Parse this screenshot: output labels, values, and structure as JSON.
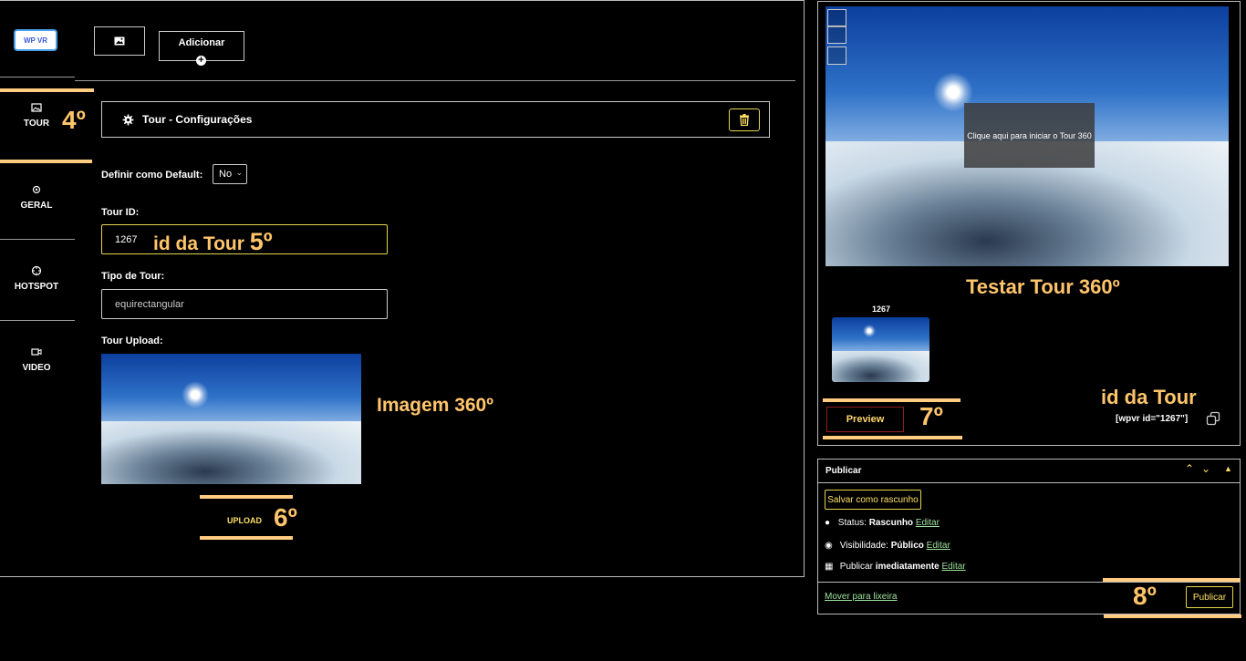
{
  "logo": {
    "text": "WP VR"
  },
  "sidebar": {
    "items": [
      {
        "label": "TOUR",
        "icon": "image-icon"
      },
      {
        "label": "GERAL",
        "icon": "gear-icon"
      },
      {
        "label": "HOTSPOT",
        "icon": "crosshair-icon"
      },
      {
        "label": "VIDEO",
        "icon": "video-icon"
      }
    ]
  },
  "toolbar": {
    "add_label": "Adicionar",
    "add_icon": "plus-circle-icon",
    "image_tab_icon": "image-icon"
  },
  "settings": {
    "title": "Tour - Configurações",
    "icon": "gear-icon",
    "delete_icon": "trash-icon"
  },
  "form": {
    "default_label": "Definir como Default:",
    "default_value": "No",
    "tour_id_label": "Tour ID:",
    "tour_id_value": "1267",
    "tour_type_label": "Tipo de Tour:",
    "tour_type_value": "equirectangular",
    "upload_label": "Tour Upload:",
    "upload_button": "UPLOAD"
  },
  "annotations": {
    "a4": "4º",
    "id_tour_5": "id da Tour",
    "a5": "5º",
    "imagem": "Imagem 360º",
    "a6": "6º",
    "testar": "Testar Tour 360º",
    "id_tour_right": "id da Tour",
    "a7": "7º",
    "a8": "8º"
  },
  "preview": {
    "overlay_text": "Clique aqui para iniciar o Tour 360",
    "thumb_id": "1267",
    "preview_button": "Preview",
    "shortcode": "[wpvr id=\"1267\"]",
    "copy_icon": "copy-icon"
  },
  "publish": {
    "title": "Publicar",
    "save_draft": "Salvar como rascunho",
    "status_label": "Status:",
    "status_value": "Rascunho",
    "visibility_label": "Visibilidade:",
    "visibility_value": "Público",
    "publish_label": "Publicar",
    "publish_value": "imediatamente",
    "edit_link": "Editar",
    "trash_link": "Mover para lixeira",
    "publish_button": "Publicar"
  },
  "colors": {
    "accent_yellow": "#ffc56b",
    "button_yellow": "#e8d44d",
    "link_green": "#9ee39e",
    "highlight_bar": "#ffcc80"
  }
}
